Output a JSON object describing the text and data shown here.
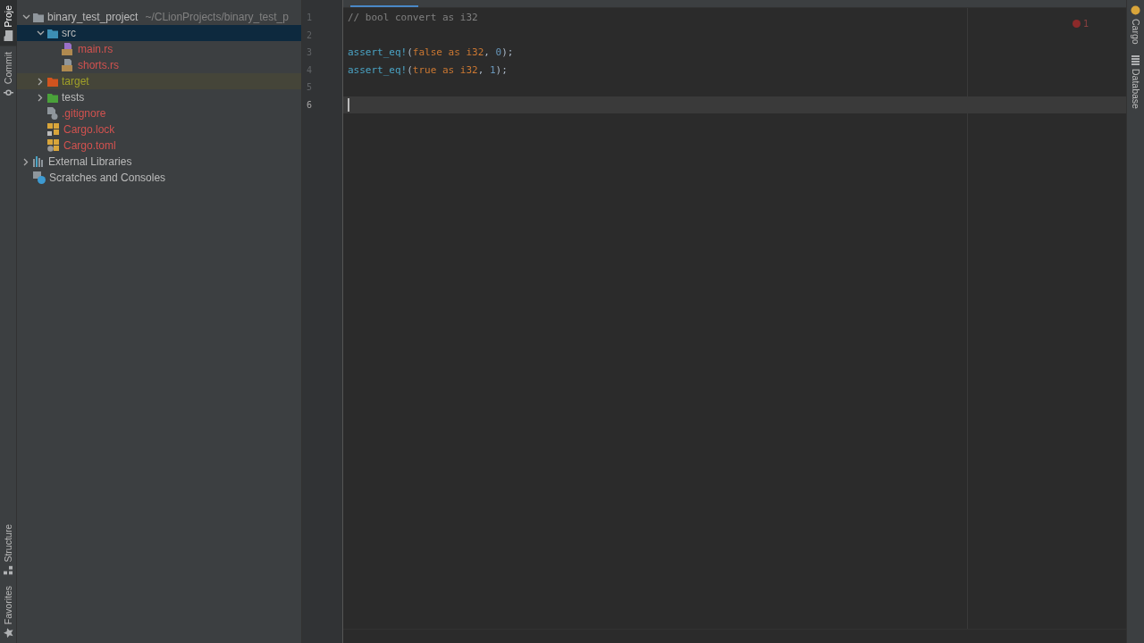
{
  "left_strip": [
    {
      "label": "Proje",
      "selected": true
    },
    {
      "label": "Commit",
      "selected": false
    }
  ],
  "left_strip_bottom": [
    {
      "label": "Structure"
    },
    {
      "label": "Favorites"
    }
  ],
  "project_tree": [
    {
      "name": "binary_test_project",
      "hint": "~/CLionProjects/binary_test_p",
      "kind": "folder",
      "color": "#8f969c",
      "unversioned": false,
      "excluded": false,
      "expanded": true,
      "selected": false,
      "children": [
        {
          "name": "src",
          "kind": "folder",
          "color": "#3d8fb5",
          "unversioned": false,
          "excluded": false,
          "expanded": true,
          "selected": true,
          "children": [
            {
              "name": "main.rs",
              "kind": "rust",
              "color": "#9a70c8",
              "unversioned": true,
              "excluded": false,
              "selected": false
            },
            {
              "name": "shorts.rs",
              "kind": "rust",
              "color": "#8f969c",
              "unversioned": true,
              "excluded": false,
              "selected": false
            }
          ]
        },
        {
          "name": "target",
          "kind": "folder",
          "color": "#d2541e",
          "excluded": true,
          "expanded": false,
          "selected": false
        },
        {
          "name": "tests",
          "kind": "folder",
          "color": "#4aa13a",
          "unversioned": false,
          "excluded": false,
          "expanded": false,
          "selected": false
        },
        {
          "name": ".gitignore",
          "kind": "ignore",
          "color": "#8f969c",
          "unversioned": true,
          "excluded": false,
          "selected": false
        },
        {
          "name": "Cargo.lock",
          "kind": "cargo-lock",
          "color": "#d9a53a",
          "unversioned": true,
          "excluded": false,
          "selected": false
        },
        {
          "name": "Cargo.toml",
          "kind": "cargo-toml",
          "color": "#d9a53a",
          "unversioned": true,
          "excluded": false,
          "selected": false
        }
      ]
    },
    {
      "name": "External Libraries",
      "kind": "libraries",
      "color": "#8f969c",
      "unversioned": false,
      "excluded": false,
      "expanded": false,
      "selected": false
    },
    {
      "name": "Scratches and Consoles",
      "kind": "scratches",
      "color": "#3d9ad1",
      "unversioned": false,
      "excluded": false,
      "selected": false
    }
  ],
  "editor": {
    "lines": [
      {
        "number": "1",
        "current": false,
        "tokens": [
          {
            "kind": "comment",
            "text": "// bool convert as i32"
          }
        ]
      },
      {
        "number": "2",
        "current": false
      },
      {
        "number": "3",
        "current": false,
        "tokens": [
          {
            "kind": "macro",
            "text": "assert_eq!"
          },
          {
            "kind": "punct",
            "text": "("
          },
          {
            "kind": "keyword",
            "text": "false as i32"
          },
          {
            "kind": "punct",
            "text": ", "
          },
          {
            "kind": "number",
            "text": "0"
          },
          {
            "kind": "punct",
            "text": ");"
          }
        ]
      },
      {
        "number": "4",
        "current": false,
        "tokens": [
          {
            "kind": "macro",
            "text": "assert_eq!"
          },
          {
            "kind": "punct",
            "text": "("
          },
          {
            "kind": "keyword",
            "text": "true as i32"
          },
          {
            "kind": "punct",
            "text": ", "
          },
          {
            "kind": "number",
            "text": "1"
          },
          {
            "kind": "punct",
            "text": ");"
          }
        ]
      },
      {
        "number": "5",
        "current": false
      },
      {
        "number": "6",
        "current": true
      }
    ],
    "error_count": "1"
  },
  "right_strip": [
    {
      "label": "Cargo"
    },
    {
      "label": "Database"
    }
  ]
}
